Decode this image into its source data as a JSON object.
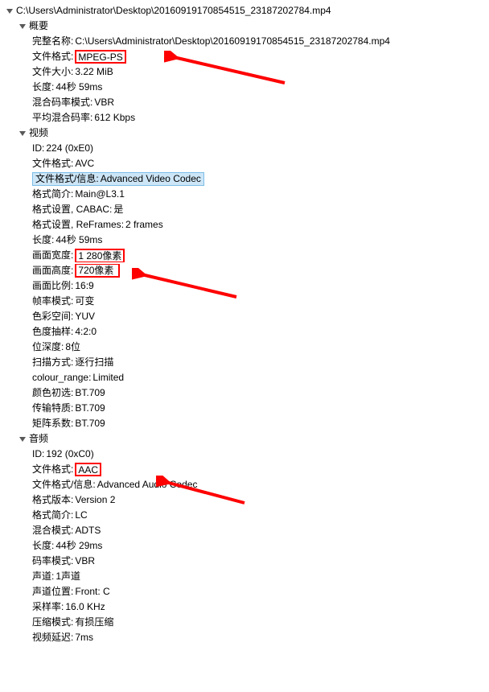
{
  "root": {
    "path": "C:\\Users\\Administrator\\Desktop\\20160919170854515_23187202784.mp4"
  },
  "sections": {
    "summary": {
      "title": "概要",
      "items": {
        "full_name_label": "完整名称",
        "full_name_value": "C:\\Users\\Administrator\\Desktop\\20160919170854515_23187202784.mp4",
        "format_label": "文件格式",
        "format_value": "MPEG-PS",
        "size_label": "文件大小",
        "size_value": "3.22 MiB",
        "duration_label": "长度",
        "duration_value": "44秒 59ms",
        "bitrate_mode_label": "混合码率模式",
        "bitrate_mode_value": "VBR",
        "avg_bitrate_label": "平均混合码率",
        "avg_bitrate_value": "612 Kbps"
      }
    },
    "video": {
      "title": "视频",
      "items": {
        "id_label": "ID",
        "id_value": "224 (0xE0)",
        "format_label": "文件格式",
        "format_value": "AVC",
        "format_info_label": "文件格式/信息",
        "format_info_value": "Advanced Video Codec",
        "profile_label": "格式简介",
        "profile_value": "Main@L3.1",
        "cabac_label": "格式设置, CABAC",
        "cabac_value": "是",
        "reframes_label": "格式设置, ReFrames",
        "reframes_value": "2 frames",
        "duration_label": "长度",
        "duration_value": "44秒 59ms",
        "width_label": "画面宽度",
        "width_value": "1 280像素",
        "height_label": "画面高度",
        "height_value": "720像素",
        "dar_label": "画面比例",
        "dar_value": "16:9",
        "fr_mode_label": "帧率模式",
        "fr_mode_value": "可变",
        "colorspace_label": "色彩空间",
        "colorspace_value": "YUV",
        "chroma_label": "色度抽样",
        "chroma_value": "4:2:0",
        "bitdepth_label": "位深度",
        "bitdepth_value": "8位",
        "scan_label": "扫描方式",
        "scan_value": "逐行扫描",
        "colour_range_label": "colour_range",
        "colour_range_value": "Limited",
        "primaries_label": "颜色初选",
        "primaries_value": "BT.709",
        "transfer_label": "传输特质",
        "transfer_value": "BT.709",
        "matrix_label": "矩阵系数",
        "matrix_value": "BT.709"
      }
    },
    "audio": {
      "title": "音频",
      "items": {
        "id_label": "ID",
        "id_value": "192 (0xC0)",
        "format_label": "文件格式",
        "format_value": "AAC",
        "format_info_label": "文件格式/信息",
        "format_info_value": "Advanced Audio Codec",
        "version_label": "格式版本",
        "version_value": "Version 2",
        "profile_label": "格式简介",
        "profile_value": "LC",
        "muxing_label": "混合模式",
        "muxing_value": "ADTS",
        "duration_label": "长度",
        "duration_value": "44秒 29ms",
        "bitrate_mode_label": "码率模式",
        "bitrate_mode_value": "VBR",
        "channels_label": "声道",
        "channels_value": "1声道",
        "ch_pos_label": "声道位置",
        "ch_pos_value": "Front: C",
        "sr_label": "采样率",
        "sr_value": "16.0 KHz",
        "compression_label": "压缩模式",
        "compression_value": "有损压缩",
        "delay_label": "视频延迟",
        "delay_value": "7ms"
      }
    }
  }
}
